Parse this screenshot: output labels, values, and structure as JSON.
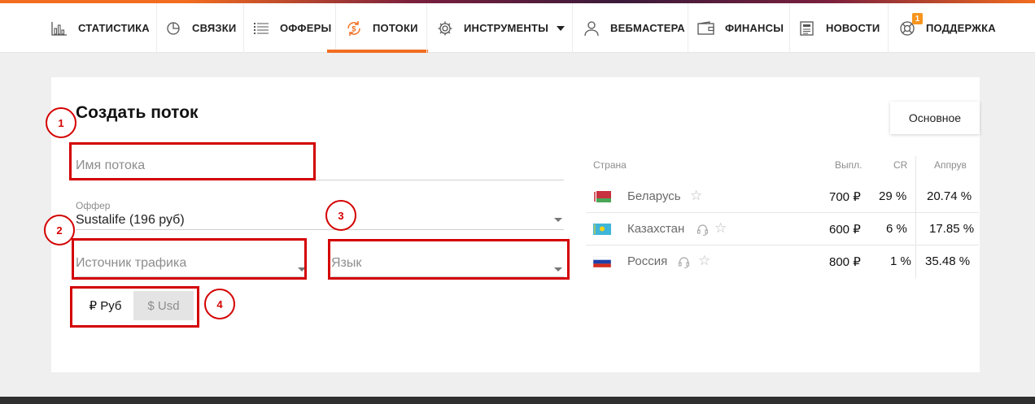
{
  "nav": {
    "items": [
      {
        "label": "СТАТИСТИКА",
        "icon": "bar-chart-icon"
      },
      {
        "label": "СВЯЗКИ",
        "icon": "pie-chart-icon"
      },
      {
        "label": "ОФФЕРЫ",
        "icon": "list-icon"
      },
      {
        "label": "ПОТОКИ",
        "icon": "money-flow-icon",
        "active": true
      },
      {
        "label": "ИНСТРУМЕНТЫ",
        "icon": "gear-icon"
      },
      {
        "label": "ВЕБМАСТЕРА",
        "icon": "users-icon"
      },
      {
        "label": "ФИНАНСЫ",
        "icon": "wallet-icon"
      },
      {
        "label": "НОВОСТИ",
        "icon": "newspaper-icon"
      },
      {
        "label": "ПОДДЕРЖКА",
        "icon": "lifebuoy-icon",
        "badge": "1"
      }
    ],
    "accent_color": "#f26d1f"
  },
  "form": {
    "title": "Создать поток",
    "stream_name_placeholder": "Имя потока",
    "offer_label": "Оффер",
    "offer_value": "Sustalife (196 руб)",
    "traffic_source_placeholder": "Источник трафика",
    "language_placeholder": "Язык",
    "currency": {
      "rub": "₽ Руб",
      "usd": "$ Usd",
      "selected": "rub"
    }
  },
  "main_button": "Основное",
  "annotations": [
    "1",
    "2",
    "3",
    "4"
  ],
  "table": {
    "headers": {
      "country": "Страна",
      "payout": "Выпл.",
      "cr": "CR",
      "approve": "Аппрув"
    },
    "rows": [
      {
        "country": "Беларусь",
        "payout": "700 ₽",
        "cr": "29 %",
        "approve": "20.74 %",
        "flag": "belarus-flag-icon",
        "support": false
      },
      {
        "country": "Казахстан",
        "payout": "600 ₽",
        "cr": "6 %",
        "approve": "17.85 %",
        "flag": "kazakhstan-flag-icon",
        "support": true
      },
      {
        "country": "Россия",
        "payout": "800 ₽",
        "cr": "1 %",
        "approve": "35.48 %",
        "flag": "russia-flag-icon",
        "support": true
      }
    ]
  }
}
